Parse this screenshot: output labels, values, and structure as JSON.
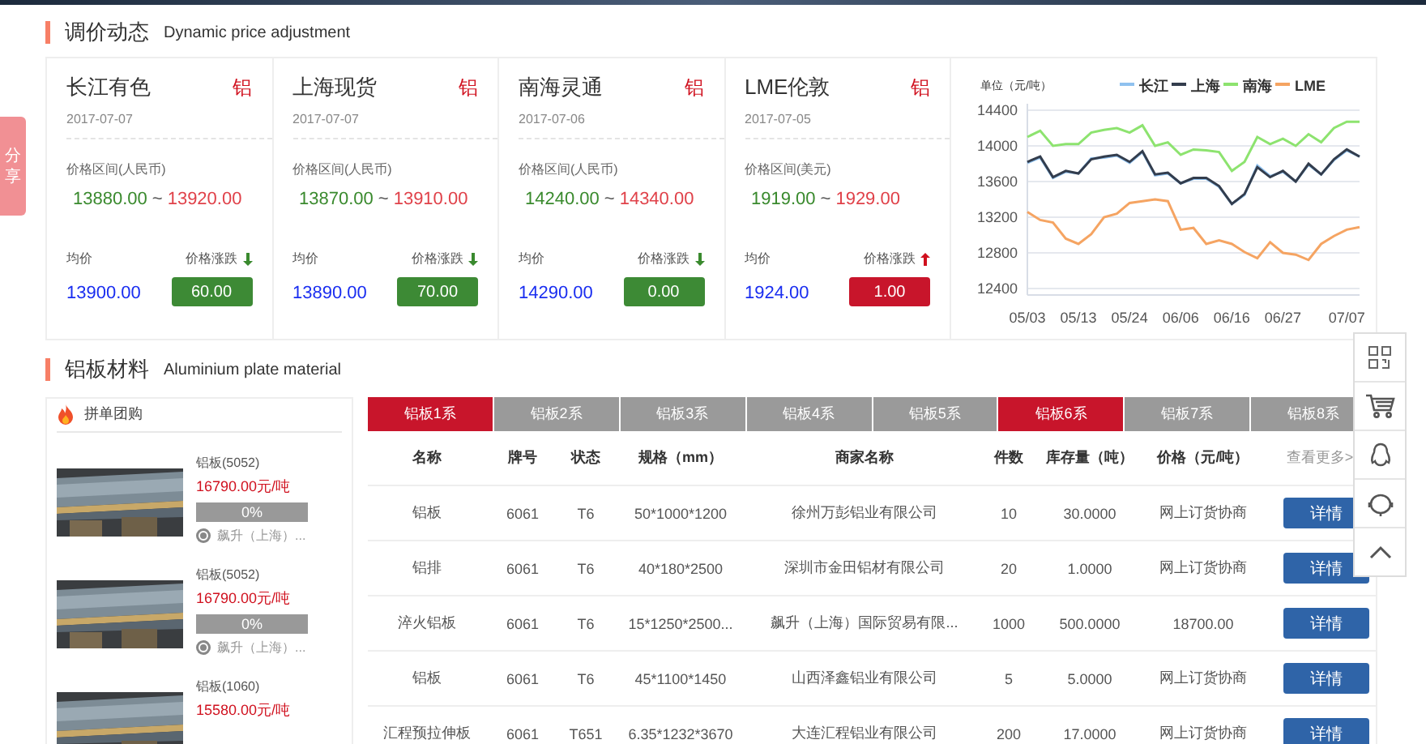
{
  "share_tab": {
    "label": "分享"
  },
  "price_section": {
    "title": "调价动态",
    "subtitle": "Dynamic price adjustment",
    "cards": [
      {
        "market": "长江有色",
        "metal": "铝",
        "date": "2017-07-07",
        "range_label": "价格区间(人民币)",
        "low": "13880.00",
        "separator": "~",
        "high": "13920.00",
        "avg_label": "均价",
        "avg": "13900.00",
        "change_label": "价格涨跌",
        "rising": false,
        "change": "60.00"
      },
      {
        "market": "上海现货",
        "metal": "铝",
        "date": "2017-07-07",
        "range_label": "价格区间(人民币)",
        "low": "13870.00",
        "separator": "~",
        "high": "13910.00",
        "avg_label": "均价",
        "avg": "13890.00",
        "change_label": "价格涨跌",
        "rising": false,
        "change": "70.00"
      },
      {
        "market": "南海灵通",
        "metal": "铝",
        "date": "2017-07-06",
        "range_label": "价格区间(人民币)",
        "low": "14240.00",
        "separator": "~",
        "high": "14340.00",
        "avg_label": "均价",
        "avg": "14290.00",
        "change_label": "价格涨跌",
        "rising": false,
        "change": "0.00"
      },
      {
        "market": "LME伦敦",
        "metal": "铝",
        "date": "2017-07-05",
        "range_label": "价格区间(美元)",
        "low": "1919.00",
        "separator": "~",
        "high": "1929.00",
        "avg_label": "均价",
        "avg": "1924.00",
        "change_label": "价格涨跌",
        "rising": true,
        "change": "1.00"
      }
    ],
    "chart_data": {
      "type": "line",
      "ylabel": "单位（元/吨）",
      "categories": [
        "05/03",
        null,
        null,
        null,
        "05/13",
        null,
        null,
        null,
        "05/24",
        null,
        null,
        null,
        "06/06",
        null,
        null,
        null,
        "06/16",
        null,
        null,
        null,
        "06/27",
        null,
        null,
        null,
        null,
        "07/07",
        null
      ],
      "ylim": [
        12400,
        14400
      ],
      "grid": true,
      "legend": true,
      "yticks": [
        12400,
        12800,
        13200,
        13600,
        14000,
        14400
      ],
      "series": [
        {
          "name": "长江",
          "color": "#8fc1ef",
          "values": [
            13810,
            13870,
            13640,
            13710,
            13690,
            13860,
            13870,
            13890,
            13810,
            13930,
            13670,
            13690,
            13580,
            13630,
            13630,
            13540,
            13350,
            13450,
            13780,
            13660,
            13710,
            13600,
            13790,
            13680,
            13840,
            13950,
            13880
          ]
        },
        {
          "name": "上海",
          "color": "#333d4d",
          "values": [
            13820,
            13880,
            13650,
            13720,
            13690,
            13850,
            13880,
            13900,
            13820,
            13940,
            13680,
            13700,
            13580,
            13640,
            13640,
            13550,
            13350,
            13460,
            13760,
            13650,
            13720,
            13600,
            13800,
            13680,
            13850,
            13960,
            13880
          ]
        },
        {
          "name": "南海",
          "color": "#8de36f",
          "values": [
            14100,
            14170,
            14000,
            14020,
            14020,
            14150,
            14180,
            14200,
            14150,
            14230,
            14000,
            14040,
            13900,
            13960,
            13950,
            13930,
            13720,
            13820,
            14100,
            14020,
            14080,
            14000,
            14130,
            14040,
            14200,
            14270,
            14270
          ]
        },
        {
          "name": "LME",
          "color": "#f5a462",
          "values": [
            13260,
            13170,
            13140,
            12960,
            12900,
            13010,
            13200,
            13240,
            13360,
            13380,
            13400,
            13380,
            13060,
            13080,
            12900,
            12940,
            12900,
            12810,
            12740,
            12920,
            12800,
            12780,
            12720,
            12900,
            12990,
            13060,
            13090
          ]
        }
      ]
    }
  },
  "material_section": {
    "title": "铝板材料",
    "subtitle": "Aluminium plate material",
    "group_buy": {
      "title": "拼单团购",
      "items": [
        {
          "kind": "picture",
          "name": "铝板(5052)",
          "price": "16790.00元/吨",
          "level": 0,
          "progress": "0%",
          "vendor": "飙升（上海）..."
        },
        {
          "kind": "picture",
          "name": "铝板(5052)",
          "price": "16790.00元/吨",
          "level": 0,
          "progress": "0%",
          "vendor": "飙升（上海）..."
        },
        {
          "kind": "picture",
          "name": "铝板(1060)",
          "price": "15580.00元/吨"
        }
      ]
    },
    "table": {
      "tabs": [
        {
          "label": "铝板1系",
          "selected": true
        },
        {
          "label": "铝板2系",
          "selected": false
        },
        {
          "label": "铝板3系",
          "selected": false
        },
        {
          "label": "铝板4系",
          "selected": false
        },
        {
          "label": "铝板5系",
          "selected": false
        },
        {
          "label": "铝板6系",
          "selected": true
        },
        {
          "label": "铝板7系",
          "selected": false
        },
        {
          "label": "铝板8系",
          "selected": false
        }
      ],
      "columns": [
        "名称",
        "牌号",
        "状态",
        "规格（mm）",
        "商家名称",
        "件数",
        "库存量（吨）",
        "价格（元/吨）"
      ],
      "more_link": "查看更多>",
      "rows": [
        {
          "cells": [
            "铝板",
            "6061",
            "T6",
            "50*1000*1200",
            "徐州万彭铝业有限公司",
            "10",
            "30.0000",
            "网上订货协商"
          ],
          "action": "详情"
        },
        {
          "cells": [
            "铝排",
            "6061",
            "T6",
            "40*180*2500",
            "深圳市金田铝材有限公司",
            "20",
            "1.0000",
            "网上订货协商"
          ],
          "action": "详情"
        },
        {
          "cells": [
            "淬火铝板",
            "6061",
            "T6",
            "15*1250*2500...",
            "飙升（上海）国际贸易有限...",
            "1000",
            "500.0000",
            "18700.00"
          ],
          "action": "详情"
        },
        {
          "cells": [
            "铝板",
            "6061",
            "T6",
            "45*1100*1450",
            "山西泽鑫铝业有限公司",
            "5",
            "5.0000",
            "网上订货协商"
          ],
          "action": "详情"
        },
        {
          "cells": [
            "汇程预拉伸板",
            "6061",
            "T651",
            "6.35*1232*3670",
            "大连汇程铝业有限公司",
            "200",
            "17.0000",
            "网上订货协商"
          ],
          "action": "详情"
        }
      ]
    }
  }
}
